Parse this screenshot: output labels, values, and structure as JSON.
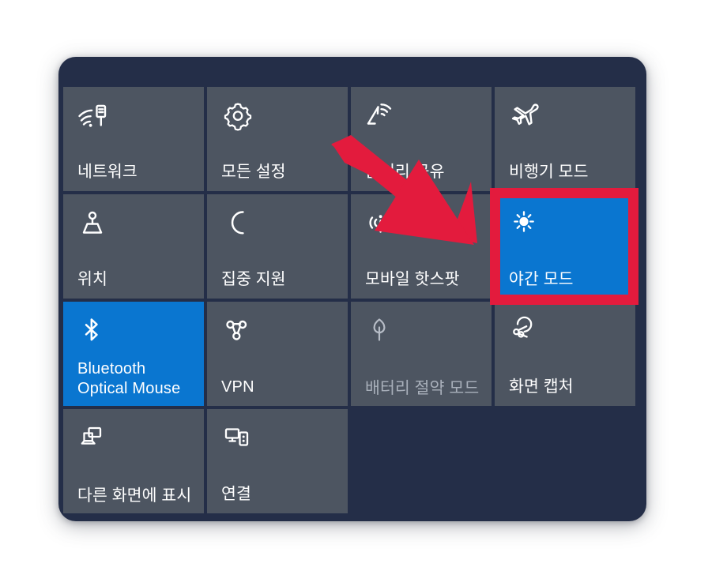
{
  "panel": {
    "name": "Windows 10 Action Center quick actions panel",
    "background_color": "#242e48",
    "tile_color": "#4d5561",
    "tile_on_color": "#0a76d0",
    "tile_text_color": "#ffffff",
    "tile_disabled_text_color": "#a9b0bb"
  },
  "tiles": [
    {
      "label": "네트워크",
      "icon": "network-wifi-icon",
      "state": "off"
    },
    {
      "label": "모든 설정",
      "icon": "gear-icon",
      "state": "off"
    },
    {
      "label": "근거리 공유",
      "icon": "nearby-share-icon",
      "state": "off"
    },
    {
      "label": "비행기 모드",
      "icon": "airplane-icon",
      "state": "off"
    },
    {
      "label": "위치",
      "icon": "location-icon",
      "state": "off"
    },
    {
      "label": "집중 지원",
      "icon": "moon-icon",
      "state": "off"
    },
    {
      "label": "모바일 핫스팟",
      "icon": "mobile-hotspot-icon",
      "state": "off"
    },
    {
      "label": "야간 모드",
      "icon": "sun-icon",
      "state": "on"
    },
    {
      "label": "Bluetooth\nOptical Mouse",
      "icon": "bluetooth-icon",
      "state": "on"
    },
    {
      "label": "VPN",
      "icon": "vpn-icon",
      "state": "off"
    },
    {
      "label": "배터리 절약 모드",
      "icon": "battery-saver-leaf-icon",
      "state": "disabled"
    },
    {
      "label": "화면 캡처",
      "icon": "screen-snip-icon",
      "state": "off"
    },
    {
      "label": "다른 화면에 표시",
      "icon": "project-display-icon",
      "state": "off"
    },
    {
      "label": "연결",
      "icon": "connect-device-icon",
      "state": "off"
    },
    {
      "label": "",
      "icon": "",
      "state": "empty"
    },
    {
      "label": "",
      "icon": "",
      "state": "empty"
    }
  ],
  "annotations": {
    "highlight_box": {
      "name": "night-light-highlight-box",
      "color": "#e31b3d",
      "target_label": "야간 모드"
    },
    "arrow": {
      "name": "pointer-arrow",
      "color": "#e31b3d",
      "direction": "down-right",
      "points_to": "야간 모드"
    }
  }
}
